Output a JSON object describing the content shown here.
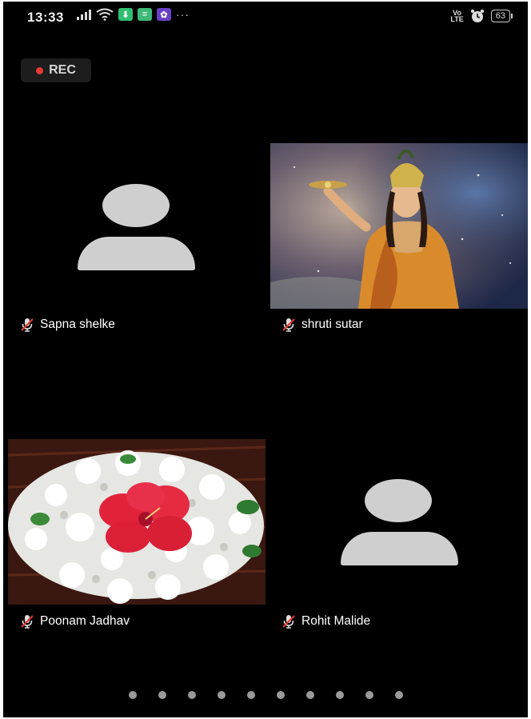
{
  "status_bar": {
    "time": "13:33",
    "volte": "Vo\nLTE",
    "battery": "63",
    "more": "···"
  },
  "recording": {
    "label": "REC"
  },
  "participants": [
    {
      "name": "Sapna shelke",
      "muted": true,
      "video": "avatar"
    },
    {
      "name": "shruti sutar",
      "muted": true,
      "video": "photo"
    },
    {
      "name": "Poonam Jadhav",
      "muted": true,
      "video": "photo"
    },
    {
      "name": "Rohit Malide",
      "muted": true,
      "video": "avatar"
    }
  ],
  "pager": {
    "pages": 10
  },
  "colors": {
    "background": "#000000",
    "avatar": "#cfcfcf",
    "rec_dot": "#e53935",
    "mute_slash": "#e53935"
  }
}
